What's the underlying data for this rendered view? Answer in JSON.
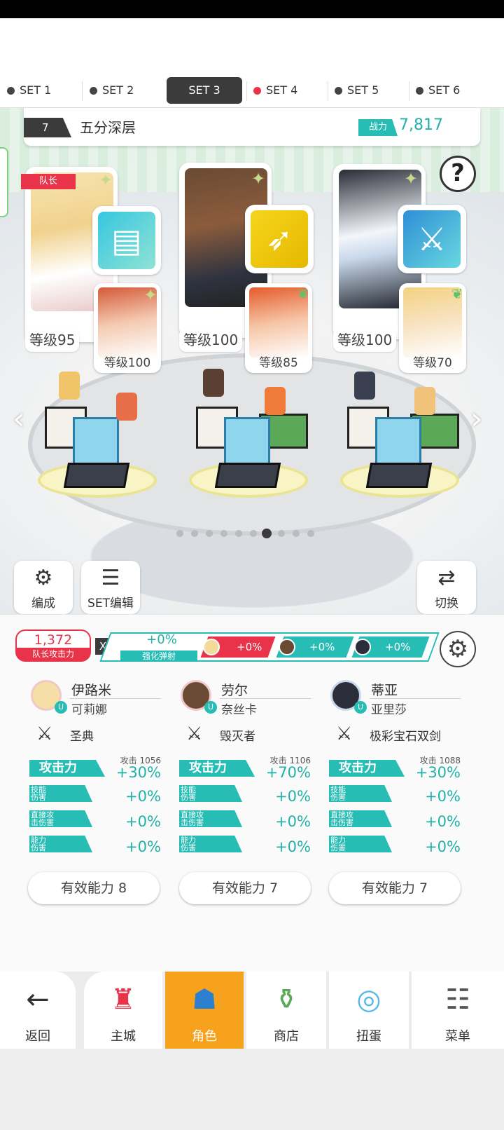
{
  "set_tabs": [
    {
      "label": "SET 1",
      "dot_color": "#444444"
    },
    {
      "label": "SET 2",
      "dot_color": "#444444"
    },
    {
      "label": "SET 3",
      "active": true
    },
    {
      "label": "SET 4",
      "dot_color": "#e8334a"
    },
    {
      "label": "SET 5",
      "dot_color": "#444444"
    },
    {
      "label": "SET 6",
      "dot_color": "#444444"
    }
  ],
  "team": {
    "number": "7",
    "name": "五分深层",
    "power_label": "战力",
    "power_value": "7,817"
  },
  "help_label": "?",
  "leader_tag": "队长",
  "heroes": [
    {
      "level": "等级95",
      "sub_level": "等级100",
      "weapon_icon": "book-icon"
    },
    {
      "level": "等级100",
      "sub_level": "等级85",
      "weapon_icon": "spear-icon"
    },
    {
      "level": "等级100",
      "sub_level": "等级70",
      "weapon_icon": "crossed-swords-icon"
    }
  ],
  "page_dots": {
    "total": 10,
    "active_index": 6
  },
  "buttons": {
    "formation": "编成",
    "set_edit": "SET编辑",
    "switch": "切换"
  },
  "leader_attack": {
    "value": "1,372",
    "label": "队长攻击力"
  },
  "multiplier": "X",
  "enhance": {
    "value": "+0%",
    "label": "强化弹射"
  },
  "chips": [
    "+0%",
    "+0%",
    "+0%"
  ],
  "columns": [
    {
      "hero": "伊路米",
      "sub": "可莉娜",
      "weapon": "圣典",
      "atk_raw": "攻击 1056",
      "stats": [
        {
          "label": "攻击力",
          "value": "+30%"
        },
        {
          "label": "技能\n伤害",
          "value": "+0%"
        },
        {
          "label": "直接攻\n击伤害",
          "value": "+0%"
        },
        {
          "label": "能力\n伤害",
          "value": "+0%"
        }
      ],
      "effective": "有效能力 8"
    },
    {
      "hero": "劳尔",
      "sub": "奈丝卡",
      "weapon": "毁灭者",
      "atk_raw": "攻击 1106",
      "stats": [
        {
          "label": "攻击力",
          "value": "+70%"
        },
        {
          "label": "技能\n伤害",
          "value": "+0%"
        },
        {
          "label": "直接攻\n击伤害",
          "value": "+0%"
        },
        {
          "label": "能力\n伤害",
          "value": "+0%"
        }
      ],
      "effective": "有效能力 7"
    },
    {
      "hero": "蒂亚",
      "sub": "亚里莎",
      "weapon": "极彩宝石双剑",
      "atk_raw": "攻击 1088",
      "stats": [
        {
          "label": "攻击力",
          "value": "+30%"
        },
        {
          "label": "技能\n伤害",
          "value": "+0%"
        },
        {
          "label": "直接攻\n击伤害",
          "value": "+0%"
        },
        {
          "label": "能力\n伤害",
          "value": "+0%"
        }
      ],
      "effective": "有效能力 7"
    }
  ],
  "nav": [
    {
      "label": "返回",
      "icon": "back-arrow-icon"
    },
    {
      "label": "主城",
      "icon": "castle-icon"
    },
    {
      "label": "角色",
      "icon": "character-icon",
      "active": true
    },
    {
      "label": "商店",
      "icon": "shop-icon"
    },
    {
      "label": "扭蛋",
      "icon": "gacha-icon"
    },
    {
      "label": "菜单",
      "icon": "menu-icon"
    }
  ],
  "colors": {
    "accent_teal": "#27bdb4",
    "accent_red": "#e8334a",
    "nav_active": "#f7a21c",
    "dark": "#3b3b3b"
  }
}
